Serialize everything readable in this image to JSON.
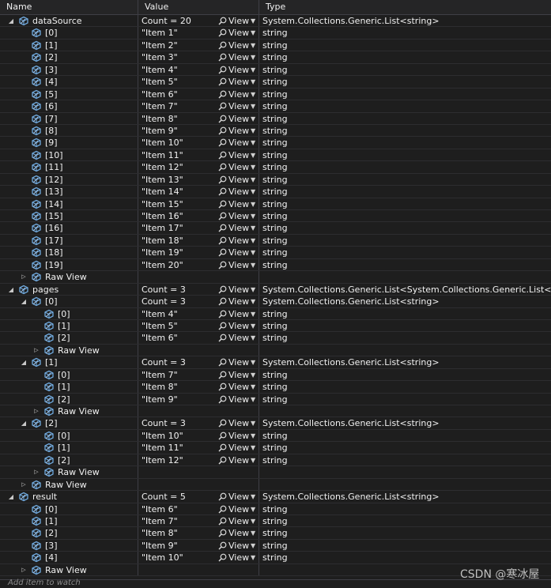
{
  "header": {
    "name": "Name",
    "value": "Value",
    "type": "Type"
  },
  "add_item": "Add item to watch",
  "watermark": "CSDN @寒冰屋",
  "view_label": "View",
  "icons": {
    "expanded": "triangle-down-icon",
    "collapsed": "triangle-right-icon",
    "variable": "cube-icon",
    "view": "magnifier-icon",
    "dropdown": "dropdown-arrow-icon"
  },
  "colors": {
    "background": "#1e1e1e",
    "header": "#252526",
    "grid": "#3f3f46",
    "icon": "#6fa8dc"
  },
  "rows": [
    {
      "level": 0,
      "expander": "expanded",
      "name": "dataSource",
      "value": "Count = 20",
      "view": true,
      "type": "System.Collections.Generic.List<string>"
    },
    {
      "level": 1,
      "expander": "",
      "name": "[0]",
      "value": "\"Item 1\"",
      "view": true,
      "type": "string"
    },
    {
      "level": 1,
      "expander": "",
      "name": "[1]",
      "value": "\"Item 2\"",
      "view": true,
      "type": "string"
    },
    {
      "level": 1,
      "expander": "",
      "name": "[2]",
      "value": "\"Item 3\"",
      "view": true,
      "type": "string"
    },
    {
      "level": 1,
      "expander": "",
      "name": "[3]",
      "value": "\"Item 4\"",
      "view": true,
      "type": "string"
    },
    {
      "level": 1,
      "expander": "",
      "name": "[4]",
      "value": "\"Item 5\"",
      "view": true,
      "type": "string"
    },
    {
      "level": 1,
      "expander": "",
      "name": "[5]",
      "value": "\"Item 6\"",
      "view": true,
      "type": "string"
    },
    {
      "level": 1,
      "expander": "",
      "name": "[6]",
      "value": "\"Item 7\"",
      "view": true,
      "type": "string"
    },
    {
      "level": 1,
      "expander": "",
      "name": "[7]",
      "value": "\"Item 8\"",
      "view": true,
      "type": "string"
    },
    {
      "level": 1,
      "expander": "",
      "name": "[8]",
      "value": "\"Item 9\"",
      "view": true,
      "type": "string"
    },
    {
      "level": 1,
      "expander": "",
      "name": "[9]",
      "value": "\"Item 10\"",
      "view": true,
      "type": "string"
    },
    {
      "level": 1,
      "expander": "",
      "name": "[10]",
      "value": "\"Item 11\"",
      "view": true,
      "type": "string"
    },
    {
      "level": 1,
      "expander": "",
      "name": "[11]",
      "value": "\"Item 12\"",
      "view": true,
      "type": "string"
    },
    {
      "level": 1,
      "expander": "",
      "name": "[12]",
      "value": "\"Item 13\"",
      "view": true,
      "type": "string"
    },
    {
      "level": 1,
      "expander": "",
      "name": "[13]",
      "value": "\"Item 14\"",
      "view": true,
      "type": "string"
    },
    {
      "level": 1,
      "expander": "",
      "name": "[14]",
      "value": "\"Item 15\"",
      "view": true,
      "type": "string"
    },
    {
      "level": 1,
      "expander": "",
      "name": "[15]",
      "value": "\"Item 16\"",
      "view": true,
      "type": "string"
    },
    {
      "level": 1,
      "expander": "",
      "name": "[16]",
      "value": "\"Item 17\"",
      "view": true,
      "type": "string"
    },
    {
      "level": 1,
      "expander": "",
      "name": "[17]",
      "value": "\"Item 18\"",
      "view": true,
      "type": "string"
    },
    {
      "level": 1,
      "expander": "",
      "name": "[18]",
      "value": "\"Item 19\"",
      "view": true,
      "type": "string"
    },
    {
      "level": 1,
      "expander": "",
      "name": "[19]",
      "value": "\"Item 20\"",
      "view": true,
      "type": "string"
    },
    {
      "level": 1,
      "expander": "collapsed",
      "name": "Raw View",
      "value": "",
      "view": false,
      "type": ""
    },
    {
      "level": 0,
      "expander": "expanded",
      "name": "pages",
      "value": "Count = 3",
      "view": true,
      "type": "System.Collections.Generic.List<System.Collections.Generic.List<string>>"
    },
    {
      "level": 1,
      "expander": "expanded",
      "name": "[0]",
      "value": "Count = 3",
      "view": true,
      "type": "System.Collections.Generic.List<string>"
    },
    {
      "level": 2,
      "expander": "",
      "name": "[0]",
      "value": "\"Item 4\"",
      "view": true,
      "type": "string"
    },
    {
      "level": 2,
      "expander": "",
      "name": "[1]",
      "value": "\"Item 5\"",
      "view": true,
      "type": "string"
    },
    {
      "level": 2,
      "expander": "",
      "name": "[2]",
      "value": "\"Item 6\"",
      "view": true,
      "type": "string"
    },
    {
      "level": 2,
      "expander": "collapsed",
      "name": "Raw View",
      "value": "",
      "view": false,
      "type": ""
    },
    {
      "level": 1,
      "expander": "expanded",
      "name": "[1]",
      "value": "Count = 3",
      "view": true,
      "type": "System.Collections.Generic.List<string>"
    },
    {
      "level": 2,
      "expander": "",
      "name": "[0]",
      "value": "\"Item 7\"",
      "view": true,
      "type": "string"
    },
    {
      "level": 2,
      "expander": "",
      "name": "[1]",
      "value": "\"Item 8\"",
      "view": true,
      "type": "string"
    },
    {
      "level": 2,
      "expander": "",
      "name": "[2]",
      "value": "\"Item 9\"",
      "view": true,
      "type": "string"
    },
    {
      "level": 2,
      "expander": "collapsed",
      "name": "Raw View",
      "value": "",
      "view": false,
      "type": ""
    },
    {
      "level": 1,
      "expander": "expanded",
      "name": "[2]",
      "value": "Count = 3",
      "view": true,
      "type": "System.Collections.Generic.List<string>"
    },
    {
      "level": 2,
      "expander": "",
      "name": "[0]",
      "value": "\"Item 10\"",
      "view": true,
      "type": "string"
    },
    {
      "level": 2,
      "expander": "",
      "name": "[1]",
      "value": "\"Item 11\"",
      "view": true,
      "type": "string"
    },
    {
      "level": 2,
      "expander": "",
      "name": "[2]",
      "value": "\"Item 12\"",
      "view": true,
      "type": "string"
    },
    {
      "level": 2,
      "expander": "collapsed",
      "name": "Raw View",
      "value": "",
      "view": false,
      "type": ""
    },
    {
      "level": 1,
      "expander": "collapsed",
      "name": "Raw View",
      "value": "",
      "view": false,
      "type": ""
    },
    {
      "level": 0,
      "expander": "expanded",
      "name": "result",
      "value": "Count = 5",
      "view": true,
      "type": "System.Collections.Generic.List<string>"
    },
    {
      "level": 1,
      "expander": "",
      "name": "[0]",
      "value": "\"Item 6\"",
      "view": true,
      "type": "string"
    },
    {
      "level": 1,
      "expander": "",
      "name": "[1]",
      "value": "\"Item 7\"",
      "view": true,
      "type": "string"
    },
    {
      "level": 1,
      "expander": "",
      "name": "[2]",
      "value": "\"Item 8\"",
      "view": true,
      "type": "string"
    },
    {
      "level": 1,
      "expander": "",
      "name": "[3]",
      "value": "\"Item 9\"",
      "view": true,
      "type": "string"
    },
    {
      "level": 1,
      "expander": "",
      "name": "[4]",
      "value": "\"Item 10\"",
      "view": true,
      "type": "string"
    },
    {
      "level": 1,
      "expander": "collapsed",
      "name": "Raw View",
      "value": "",
      "view": false,
      "type": ""
    }
  ]
}
